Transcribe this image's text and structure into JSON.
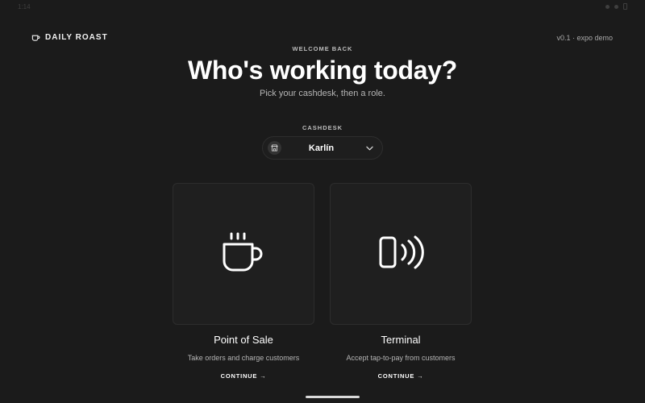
{
  "statusbar": {
    "time": "1:14"
  },
  "brand": {
    "icon": "coffee-cup-icon",
    "name": "DAILY ROAST"
  },
  "version": "v0.1 · expo demo",
  "hero": {
    "eyebrow": "WELCOME BACK",
    "title": "Who's working today?",
    "subtitle": "Pick your cashdesk, then a role."
  },
  "cashdesk": {
    "label": "CASHDESK",
    "icon": "store-icon",
    "selected": "Karlín"
  },
  "roles": [
    {
      "icon": "coffee-cup-icon",
      "title": "Point of Sale",
      "description": "Take orders and charge customers",
      "cta": "CONTINUE →"
    },
    {
      "icon": "tap-to-pay-icon",
      "title": "Terminal",
      "description": "Accept tap-to-pay from customers",
      "cta": "CONTINUE →"
    }
  ],
  "colors": {
    "background": "#1b1b1b",
    "card": "#1f1f1f",
    "text": "#ffffff",
    "muted": "#b5b5b5"
  }
}
